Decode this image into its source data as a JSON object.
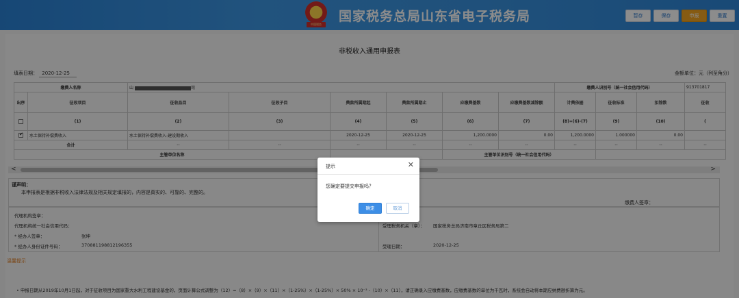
{
  "header": {
    "title": "国家税务总局山东省电子税务局",
    "emblem_text": "中国税务",
    "buttons": [
      {
        "label": "暂存",
        "primary": false
      },
      {
        "label": "保存",
        "primary": false
      },
      {
        "label": "申报",
        "primary": true
      },
      {
        "label": "重置",
        "primary": false
      }
    ]
  },
  "form": {
    "title": "非税收入通用申报表",
    "fill_date_label": "填表日期：",
    "fill_date": "2020-12-25",
    "unit": "金额单位：元（列至角分）",
    "payer_name_label": "缴费人名称",
    "payer_name_prefix": "山",
    "payer_name_suffix": "司",
    "payer_id_label": "缴费人识别号（统一社会信用代码）",
    "payer_id_value": "913701817",
    "columns": [
      "出序",
      "征收项目",
      "征收品目",
      "征收子目",
      "费款所属期起",
      "费款所属期止",
      "应缴费基数",
      "应缴费基数减除额",
      "计费依据",
      "征收标准",
      "扣除数",
      "征收"
    ],
    "column_numbers": [
      "",
      "(1)",
      "(2)",
      "(3)",
      "(4)",
      "(5)",
      "(6)",
      "(7)",
      "(8)=(6)-(7)",
      "(9)",
      "(10)",
      "("
    ],
    "row": {
      "item": "水土保持补偿费收入",
      "sub_item": "水土保持补偿费收入-建设期收入",
      "child": "",
      "start": "2020-12-25",
      "end": "2020-12-25",
      "base": "1,200.0000",
      "deduct": "0.00",
      "basis": "1,200.0000",
      "standard": "1.000000",
      "minus": "0.00"
    },
    "total_label": "合计",
    "dash": "--",
    "authority_label": "主管单位名称",
    "authority_id_label": "主管单位识别号（统一社会信用代码）",
    "scroll_left": "<",
    "scroll_right": ">"
  },
  "declaration": {
    "title": "谨声明：",
    "text": "本申报表是根据非税收入法律法规及相关规定填报的，内容是真实的、可靠的、完整的。",
    "signer": "缴费人签章："
  },
  "agent": {
    "agency_seal": "代理机构签章：",
    "agency_code": "代理机构统一社会信用代码：",
    "handler_label": "* 经办人签章：",
    "handler_value": "张坤",
    "handler_id_label": "* 经办人身份证件号码：",
    "handler_id_value": "370881198812196355",
    "office_label": "受理税务机关（章）：",
    "office_value": "国家税务总局济南市章丘区税务局第二",
    "accept_date_label": "受理日期：",
    "accept_date_value": "2020-12-25"
  },
  "tips": {
    "title": "温馨提示",
    "line": "• 申报日期从2019年10月1日起，对于征收项目为国家重大水利工程建设基金的，页面计算公式调整为（12）=（8）×（9）×（11）×（1-25%）×（1-25%）× 50% × 10⁻³ -（10）×（11），请正确录入应缴费基数，应缴费基数的单位为千瓦时，系统会自动将本期应纳费额折算为元。"
  },
  "dialog": {
    "title": "提示",
    "message": "您确定要提交申报吗？",
    "ok": "确定",
    "cancel": "取消"
  }
}
